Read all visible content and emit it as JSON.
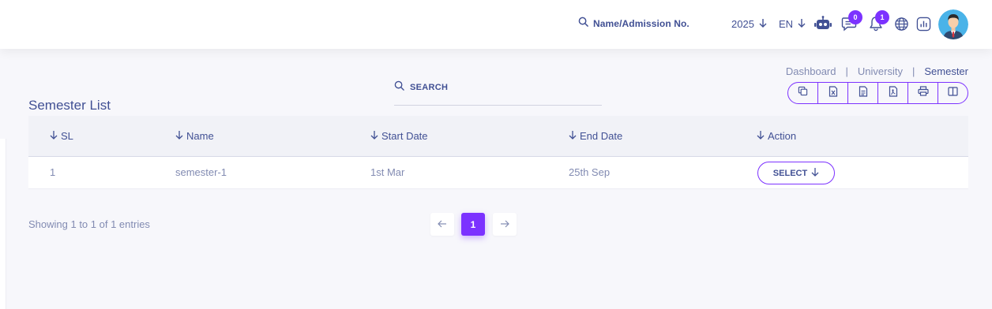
{
  "header": {
    "search_label": "Name/Admission No.",
    "year": "2025",
    "language": "EN",
    "chat_count": "0",
    "notification_count": "1"
  },
  "breadcrumb": [
    "Dashboard",
    "University",
    "Semester"
  ],
  "page_title": "Semester List",
  "table_search_label": "SEARCH",
  "export_buttons": [
    "copy-icon",
    "excel-icon",
    "csv-icon",
    "pdf-icon",
    "print-icon",
    "columns-icon"
  ],
  "table": {
    "columns": [
      "SL",
      "Name",
      "Start Date",
      "End Date",
      "Action"
    ],
    "rows": [
      {
        "sl": "1",
        "name": "semester-1",
        "start_date": "1st Mar",
        "end_date": "25th Sep",
        "action": "SELECT"
      }
    ]
  },
  "footer": {
    "showing": "Showing 1 to 1 of 1 entries",
    "current_page": "1"
  },
  "colors": {
    "accent": "#7c32ff",
    "text": "#415094",
    "muted": "#828bb2",
    "background": "#f7f7fb"
  }
}
